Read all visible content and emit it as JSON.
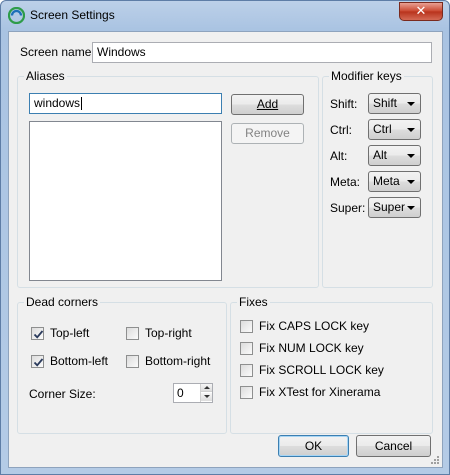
{
  "window": {
    "title": "Screen Settings",
    "close_glyph": "✕",
    "app_icon": "synergy-app-icon"
  },
  "screen_name": {
    "label": "Screen name:",
    "value": "Windows"
  },
  "aliases": {
    "title": "Aliases",
    "input_value": "windows",
    "add_label": "Add",
    "remove_label": "Remove",
    "items": []
  },
  "modifier_keys": {
    "title": "Modifier keys",
    "rows": [
      {
        "label": "Shift:",
        "value": "Shift"
      },
      {
        "label": "Ctrl:",
        "value": "Ctrl"
      },
      {
        "label": "Alt:",
        "value": "Alt"
      },
      {
        "label": "Meta:",
        "value": "Meta"
      },
      {
        "label": "Super:",
        "value": "Super"
      }
    ]
  },
  "dead_corners": {
    "title": "Dead corners",
    "top_left": {
      "label": "Top-left",
      "checked": true
    },
    "top_right": {
      "label": "Top-right",
      "checked": false
    },
    "bottom_left": {
      "label": "Bottom-left",
      "checked": true
    },
    "bottom_right": {
      "label": "Bottom-right",
      "checked": false
    },
    "corner_size": {
      "label": "Corner Size:",
      "value": "0"
    }
  },
  "fixes": {
    "title": "Fixes",
    "items": [
      {
        "label": "Fix CAPS LOCK key",
        "checked": false
      },
      {
        "label": "Fix NUM LOCK key",
        "checked": false
      },
      {
        "label": "Fix SCROLL LOCK key",
        "checked": false
      },
      {
        "label": "Fix XTest for Xinerama",
        "checked": false
      }
    ]
  },
  "footer": {
    "ok_label": "OK",
    "cancel_label": "Cancel"
  },
  "colors": {
    "accent": "#3c7fb1",
    "title_gradient": "#a9c3e2",
    "close_red": "#c9452d"
  }
}
